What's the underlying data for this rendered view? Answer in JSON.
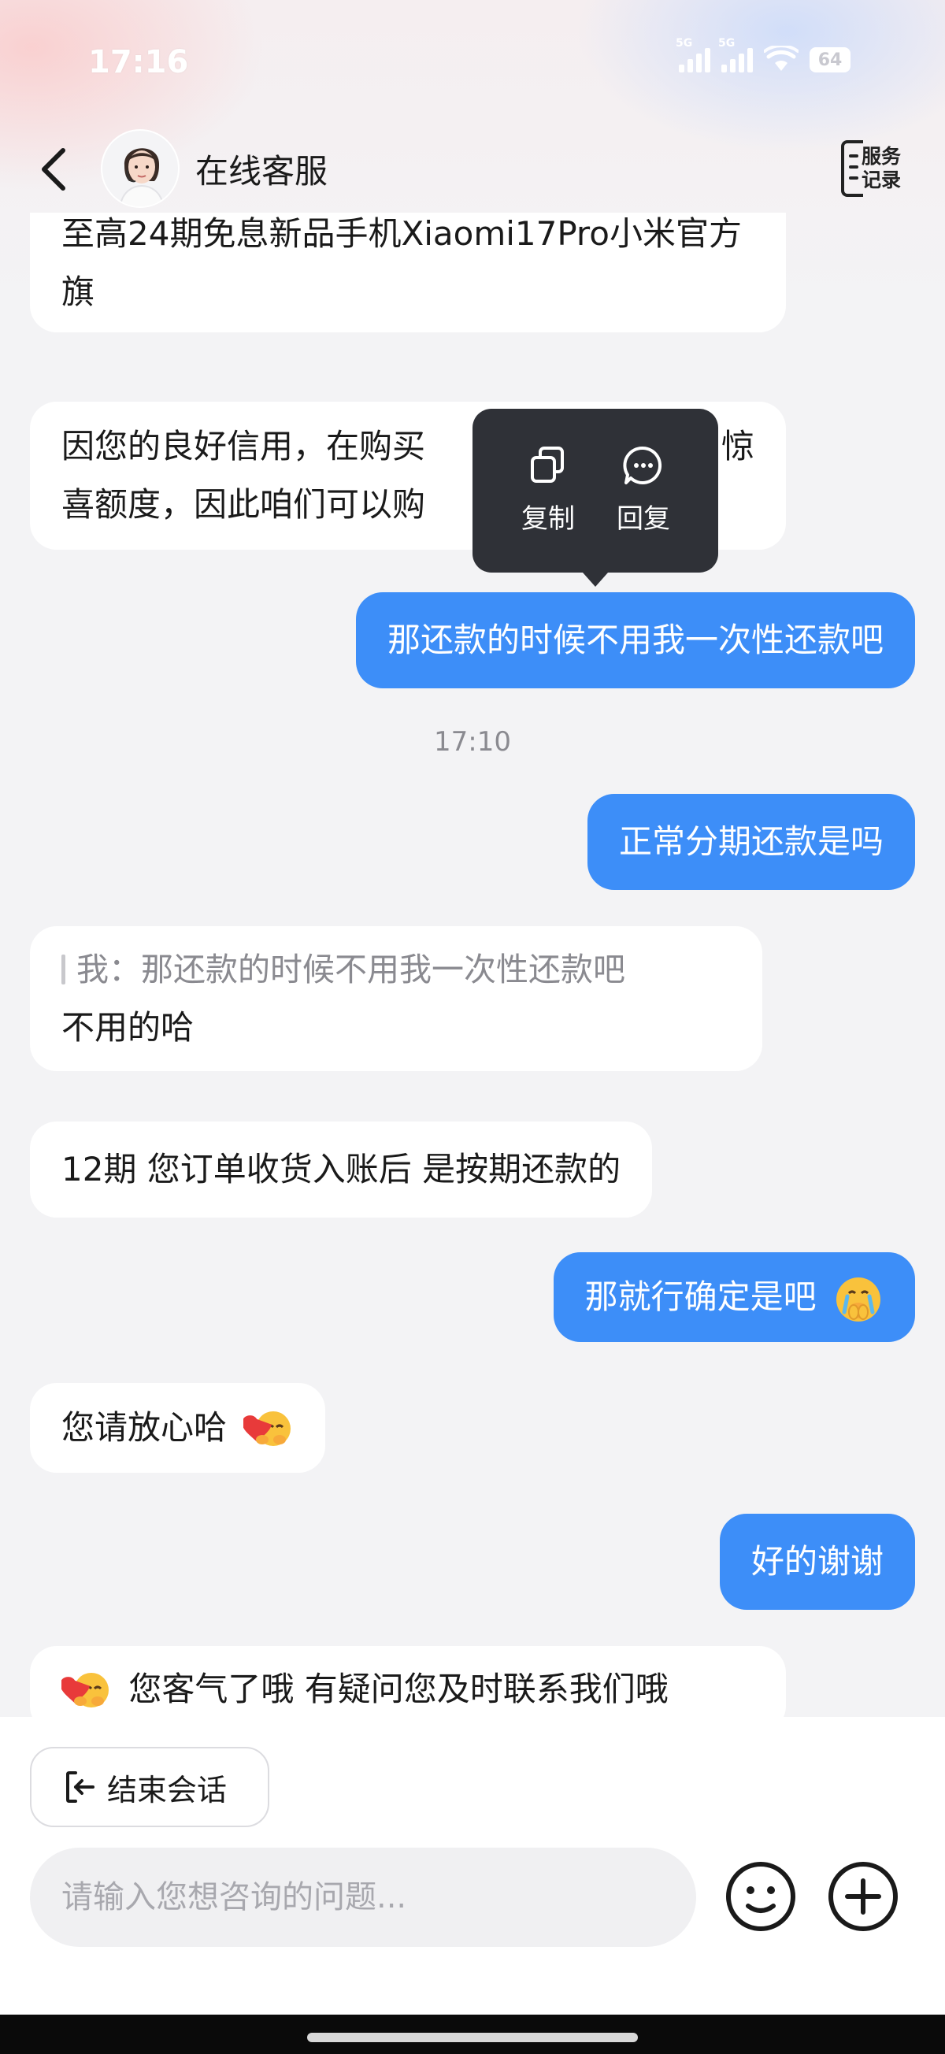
{
  "status_bar": {
    "time": "17:16",
    "network_1": "5G",
    "network_2": "5G",
    "battery": "64"
  },
  "header": {
    "back_icon": "chevron-left-icon",
    "title": "在线客服",
    "service_record": "服务\n记录"
  },
  "messages": {
    "m1": "至高24期免息新品手机Xiaomi17Pro小米官方旗",
    "m2_line1": "因您的良好信用，在购买",
    "m2_line1_end": "惊",
    "m2_line2": "喜额度，因此咱们可以购",
    "m3": "那还款的时候不用我一次性还款吧",
    "timestamp": "17:10",
    "m4": "正常分期还款是吗",
    "m5_quote": "我：那还款的时候不用我一次性还款吧",
    "m5": "不用的哈",
    "m6": "12期 您订单收货入账后 是按期还款的",
    "m7": "那就行确定是吧",
    "m8": "您请放心哈",
    "m9": "好的谢谢",
    "m10": "您客气了哦 有疑问您及时联系我们哦"
  },
  "context_menu": {
    "copy": "复制",
    "reply": "回复"
  },
  "footer": {
    "end_session": "结束会话",
    "input_placeholder": "请输入您想咨询的问题...",
    "emoji_icon": "smiley-icon",
    "plus_icon": "plus-circle-icon"
  },
  "colors": {
    "accent": "#3d8ef8",
    "popup_bg": "#2f3137",
    "page_bg": "#f3f3f5"
  }
}
